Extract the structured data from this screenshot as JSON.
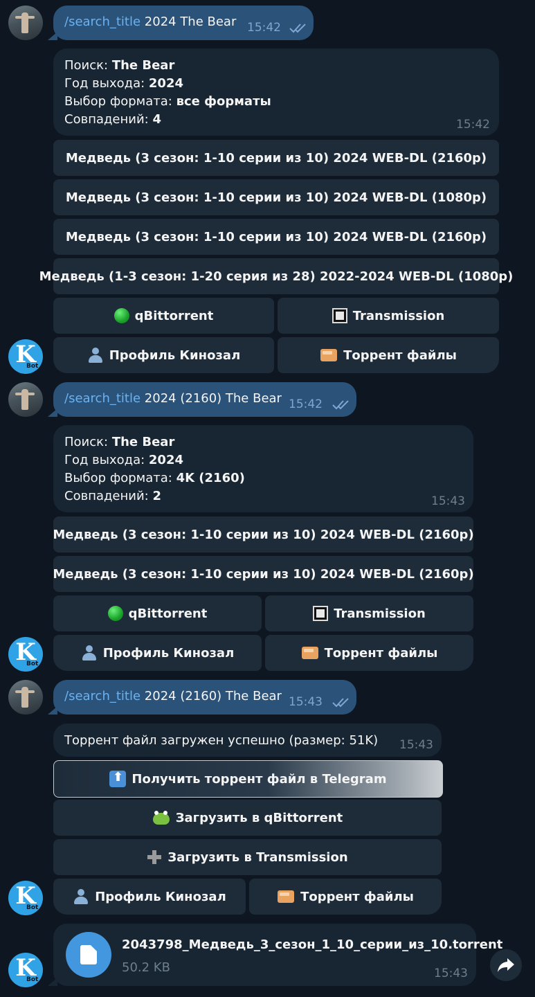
{
  "messages": [
    {
      "type": "outgoing",
      "command": "/search_title",
      "text": " 2024 The Bear",
      "time": "15:42"
    },
    {
      "type": "incoming",
      "lines": [
        {
          "label": "Поиск: ",
          "value": "The Bear"
        },
        {
          "label": "Год выхода: ",
          "value": "2024"
        },
        {
          "label": "Выбор формата: ",
          "value": "все форматы"
        },
        {
          "label": "Совпадений: ",
          "value": "4"
        }
      ],
      "time": "15:42",
      "results": [
        "Медведь (3 сезон: 1-10 серии из 10) 2024 WEB-DL (2160p)",
        "Медведь (3 сезон: 1-10 серии из 10) 2024 WEB-DL (1080p)",
        "Медведь (3 сезон: 1-10 серии из 10) 2024 WEB-DL (2160p)",
        "Медведь (1-3 сезон: 1-20 серия из 28) 2022-2024 WEB-DL (1080p)"
      ],
      "client_buttons": [
        "qBittorrent",
        "Transmission"
      ],
      "footer_buttons": [
        "Профиль Кинозал",
        "Торрент файлы"
      ]
    },
    {
      "type": "outgoing",
      "command": "/search_title",
      "text": " 2024 (2160) The Bear",
      "time": "15:42"
    },
    {
      "type": "incoming",
      "lines": [
        {
          "label": "Поиск: ",
          "value": "The Bear"
        },
        {
          "label": "Год выхода: ",
          "value": "2024"
        },
        {
          "label": "Выбор формата: ",
          "value": "4K (2160)"
        },
        {
          "label": "Совпадений: ",
          "value": "2"
        }
      ],
      "time": "15:43",
      "results": [
        "Медведь (3 сезон: 1-10 серии из 10) 2024 WEB-DL (2160p)",
        "Медведь (3 сезон: 1-10 серии из 10) 2024 WEB-DL (2160p)"
      ],
      "client_buttons": [
        "qBittorrent",
        "Transmission"
      ],
      "footer_buttons": [
        "Профиль Кинозал",
        "Торрент файлы"
      ]
    },
    {
      "type": "outgoing",
      "command": "/search_title",
      "text": " 2024 (2160) The Bear",
      "time": "15:43"
    },
    {
      "type": "incoming",
      "text": "Торрент файл загружен успешно (размер: 51K)",
      "time": "15:43",
      "actions": [
        "Получить торрент файл в Telegram",
        "Загрузить в qBittorrent",
        "Загрузить в Transmission"
      ],
      "footer_buttons": [
        "Профиль Кинозал",
        "Торрент файлы"
      ]
    },
    {
      "type": "incoming-file",
      "filename": "2043798_Медведь_3_сезон_1_10_серии_из_10.torrent",
      "size": "50.2 KB",
      "time": "15:43"
    }
  ],
  "bot_avatar": {
    "letter": "K",
    "sub": "Bot"
  },
  "colors": {
    "background": "#0e1621",
    "outgoing_bubble": "#2b5278",
    "incoming_bubble": "#182533",
    "keyboard_button": "#1e2c3a",
    "accent": "#4397de",
    "command_link": "#6ab2f2"
  },
  "icons": {
    "read_receipt": "double-check-icon",
    "share": "forward-arrow-icon",
    "file": "document-icon"
  }
}
